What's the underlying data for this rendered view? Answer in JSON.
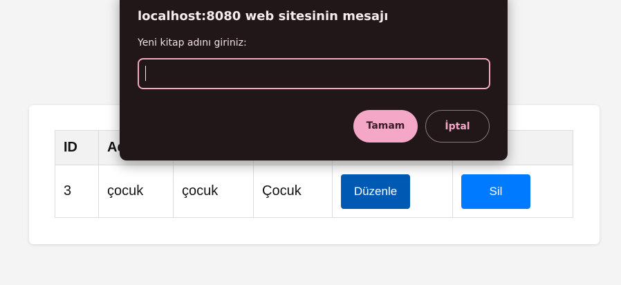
{
  "dialog": {
    "title": "localhost:8080 web sitesinin mesajı",
    "message": "Yeni kitap adını giriniz:",
    "input_value": "",
    "ok_label": "Tamam",
    "cancel_label": "İptal",
    "accent_color": "#f5a7c7",
    "background_color": "#211719"
  },
  "table": {
    "headers": [
      "ID",
      "Ad",
      "",
      "",
      "",
      ""
    ],
    "rows": [
      {
        "id": "3",
        "col2": "çocuk",
        "col3": "çocuk",
        "col4": "Çocuk",
        "edit_label": "Düzenle",
        "delete_label": "Sil"
      }
    ]
  },
  "colors": {
    "edit_button": "#0059b3",
    "delete_button": "#007bff"
  }
}
